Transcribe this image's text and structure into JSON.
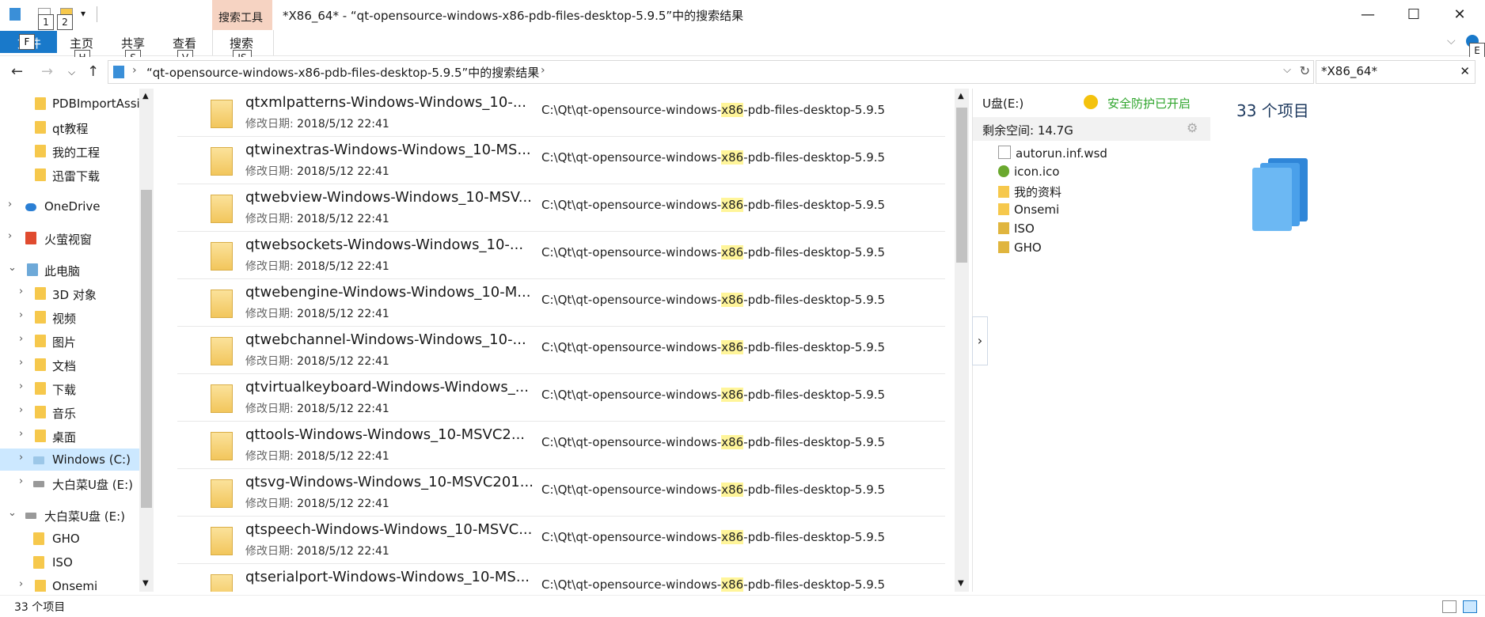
{
  "window": {
    "title": "*X86_64* - “qt-opensource-windows-x86-pdb-files-desktop-5.9.5”中的搜索结果",
    "context_tab": "搜索工具",
    "controls": {
      "minimize": "—",
      "maximize": "☐",
      "close": "✕"
    }
  },
  "quick_access_keytips": [
    "1",
    "2"
  ],
  "ribbon": {
    "file": {
      "label": "文件",
      "keytip": "F"
    },
    "tabs": [
      {
        "label": "主页",
        "keytip": "H"
      },
      {
        "label": "共享",
        "keytip": "S"
      },
      {
        "label": "查看",
        "keytip": "V"
      },
      {
        "label": "搜索",
        "keytip": "JS"
      }
    ],
    "help_keytip": "E"
  },
  "address": {
    "breadcrumb": "“qt-opensource-windows-x86-pdb-files-desktop-5.9.5”中的搜索结果",
    "search_value": "*X86_64*"
  },
  "sidebar": {
    "items": [
      {
        "label": "PDBImportAssi",
        "icon": "folder-icon"
      },
      {
        "label": "qt教程",
        "icon": "folder-icon"
      },
      {
        "label": "我的工程",
        "icon": "folder-icon"
      },
      {
        "label": "迅雷下载",
        "icon": "folder-icon"
      },
      {
        "label": "OneDrive",
        "icon": "cloud-icon"
      },
      {
        "label": "火萤视窗",
        "icon": "windows-icon"
      },
      {
        "label": "此电脑",
        "icon": "computer-icon"
      },
      {
        "label": "3D 对象",
        "icon": "3d-objects-icon"
      },
      {
        "label": "视频",
        "icon": "video-icon"
      },
      {
        "label": "图片",
        "icon": "pictures-icon"
      },
      {
        "label": "文档",
        "icon": "documents-icon"
      },
      {
        "label": "下载",
        "icon": "downloads-icon"
      },
      {
        "label": "音乐",
        "icon": "music-icon"
      },
      {
        "label": "桌面",
        "icon": "desktop-icon"
      },
      {
        "label": "Windows (C:)",
        "icon": "drive-icon"
      },
      {
        "label": "大白菜U盘 (E:)",
        "icon": "usb-drive-icon"
      },
      {
        "label": "大白菜U盘 (E:)",
        "icon": "usb-drive-icon"
      },
      {
        "label": "GHO",
        "icon": "folder-icon"
      },
      {
        "label": "ISO",
        "icon": "folder-icon"
      },
      {
        "label": "Onsemi",
        "icon": "folder-icon"
      }
    ]
  },
  "results": {
    "date_label": "修改日期:",
    "path_prefix": "C:\\Qt\\qt-opensource-windows-",
    "path_highlight": "x86",
    "path_suffix": "-pdb-files-desktop-5.9.5",
    "items": [
      {
        "name": "qtxmlpatterns-Windows-Windows_10-...",
        "date": "2018/5/12 22:41"
      },
      {
        "name": "qtwinextras-Windows-Windows_10-MS...",
        "date": "2018/5/12 22:41"
      },
      {
        "name": "qtwebview-Windows-Windows_10-MSV...",
        "date": "2018/5/12 22:41"
      },
      {
        "name": "qtwebsockets-Windows-Windows_10-...",
        "date": "2018/5/12 22:41"
      },
      {
        "name": "qtwebengine-Windows-Windows_10-M...",
        "date": "2018/5/12 22:41"
      },
      {
        "name": "qtwebchannel-Windows-Windows_10-...",
        "date": "2018/5/12 22:41"
      },
      {
        "name": "qtvirtualkeyboard-Windows-Windows_...",
        "date": "2018/5/12 22:41"
      },
      {
        "name": "qttools-Windows-Windows_10-MSVC2...",
        "date": "2018/5/12 22:41"
      },
      {
        "name": "qtsvg-Windows-Windows_10-MSVC201...",
        "date": "2018/5/12 22:41"
      },
      {
        "name": "qtspeech-Windows-Windows_10-MSVC...",
        "date": "2018/5/12 22:41"
      },
      {
        "name": "qtserialport-Windows-Windows_10-MS...",
        "date": ""
      }
    ]
  },
  "panel": {
    "drive": "U盘(E:)",
    "protection": "安全防护已开启",
    "free_space": "剩余空间: 14.7G",
    "items": [
      {
        "label": "autorun.inf.wsd",
        "icon": "file-icon"
      },
      {
        "label": "icon.ico",
        "icon": "ico-file-icon"
      },
      {
        "label": "我的资料",
        "icon": "folder-icon"
      },
      {
        "label": "Onsemi",
        "icon": "folder-icon"
      },
      {
        "label": "ISO",
        "icon": "locked-folder-icon"
      },
      {
        "label": "GHO",
        "icon": "locked-folder-icon"
      }
    ]
  },
  "details": {
    "count": "33 个项目"
  },
  "status": {
    "count": "33 个项目"
  },
  "colors": {
    "accent": "#1979ca",
    "selection": "#cce8ff",
    "highlight": "#fff59a",
    "safe_green": "#2fa52c",
    "context_tab": "#f6d3c2"
  }
}
